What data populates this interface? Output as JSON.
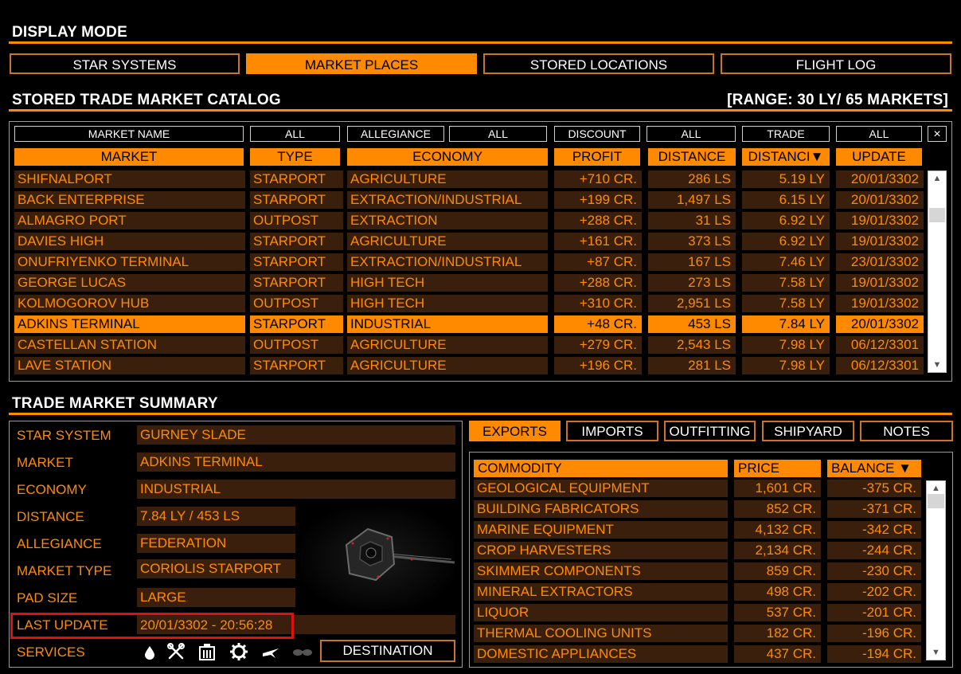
{
  "display_mode": {
    "title": "DISPLAY MODE",
    "buttons": [
      {
        "label": "STAR SYSTEMS",
        "active": false
      },
      {
        "label": "MARKET PLACES",
        "active": true
      },
      {
        "label": "STORED LOCATIONS",
        "active": false
      },
      {
        "label": "FLIGHT LOG",
        "active": false
      }
    ]
  },
  "catalog": {
    "title": "STORED TRADE MARKET CATALOG",
    "range": "[RANGE: 30 LY/ 65 MARKETS]",
    "filters": [
      "MARKET NAME",
      "ALL",
      "ALLEGIANCE",
      "ALL",
      "DISCOUNT",
      "ALL",
      "TRADE",
      "ALL"
    ],
    "close": "×",
    "columns": [
      "MARKET",
      "TYPE",
      "ECONOMY",
      "PROFIT",
      "DISTANCE",
      "DISTANCI▼",
      "UPDATE"
    ],
    "rows": [
      [
        "SHIFNALPORT",
        "STARPORT",
        "AGRICULTURE",
        "+710 CR.",
        "286 LS",
        "5.19 LY",
        "20/01/3302"
      ],
      [
        "BACK ENTERPRISE",
        "STARPORT",
        "EXTRACTION/INDUSTRIAL",
        "+199 CR.",
        "1,497 LS",
        "6.15 LY",
        "20/01/3302"
      ],
      [
        "ALMAGRO PORT",
        "OUTPOST",
        "EXTRACTION",
        "+288 CR.",
        "31 LS",
        "6.92 LY",
        "19/01/3302"
      ],
      [
        "DAVIES HIGH",
        "STARPORT",
        "AGRICULTURE",
        "+161 CR.",
        "373 LS",
        "6.92 LY",
        "19/01/3302"
      ],
      [
        "ONUFRIYENKO TERMINAL",
        "STARPORT",
        "EXTRACTION/INDUSTRIAL",
        "+87 CR.",
        "167 LS",
        "7.46 LY",
        "23/01/3302"
      ],
      [
        "GEORGE LUCAS",
        "STARPORT",
        "HIGH TECH",
        "+288 CR.",
        "273 LS",
        "7.58 LY",
        "19/01/3302"
      ],
      [
        "KOLMOGOROV HUB",
        "OUTPOST",
        "HIGH TECH",
        "+310 CR.",
        "2,951 LS",
        "7.58 LY",
        "19/01/3302"
      ],
      [
        "ADKINS TERMINAL",
        "STARPORT",
        "INDUSTRIAL",
        "+48 CR.",
        "453 LS",
        "7.84 LY",
        "20/01/3302"
      ],
      [
        "CASTELLAN STATION",
        "OUTPOST",
        "AGRICULTURE",
        "+279 CR.",
        "2,543 LS",
        "7.98 LY",
        "06/12/3301"
      ],
      [
        "LAVE STATION",
        "STARPORT",
        "AGRICULTURE",
        "+196 CR.",
        "281 LS",
        "7.98 LY",
        "06/12/3301"
      ]
    ],
    "selected_row": "ADKINS TERMINAL"
  },
  "summary": {
    "title": "TRADE MARKET SUMMARY",
    "fields": {
      "star_system": {
        "label": "STAR SYSTEM",
        "value": "GURNEY SLADE"
      },
      "market": {
        "label": "MARKET",
        "value": "ADKINS TERMINAL"
      },
      "economy": {
        "label": "ECONOMY",
        "value": "INDUSTRIAL"
      },
      "distance": {
        "label": "DISTANCE",
        "value": "7.84 LY / 453 LS"
      },
      "allegiance": {
        "label": "ALLEGIANCE",
        "value": "FEDERATION"
      },
      "market_type": {
        "label": "MARKET TYPE",
        "value": "CORIOLIS STARPORT"
      },
      "pad_size": {
        "label": "PAD SIZE",
        "value": "LARGE"
      },
      "last_update": {
        "label": "LAST UPDATE",
        "value": "20/01/3302 - 20:56:28"
      }
    },
    "services_label": "SERVICES",
    "service_icons": [
      "refuel-icon",
      "repair-icon",
      "rearm-icon",
      "outfitting-icon",
      "shipyard-icon",
      "black-market-icon"
    ],
    "destination_label": "DESTINATION"
  },
  "tabs": [
    {
      "label": "EXPORTS",
      "active": true
    },
    {
      "label": "IMPORTS",
      "active": false
    },
    {
      "label": "OUTFITTING",
      "active": false
    },
    {
      "label": "SHIPYARD",
      "active": false
    },
    {
      "label": "NOTES",
      "active": false
    }
  ],
  "commodities": {
    "columns": [
      "COMMODITY",
      "PRICE",
      "BALANCE ▼"
    ],
    "rows": [
      [
        "GEOLOGICAL EQUIPMENT",
        "1,601 CR.",
        "-375 CR."
      ],
      [
        "BUILDING FABRICATORS",
        "852 CR.",
        "-371 CR."
      ],
      [
        "MARINE EQUIPMENT",
        "4,132 CR.",
        "-342 CR."
      ],
      [
        "CROP HARVESTERS",
        "2,134 CR.",
        "-244 CR."
      ],
      [
        "SKIMMER COMPONENTS",
        "859 CR.",
        "-230 CR."
      ],
      [
        "MINERAL EXTRACTORS",
        "498 CR.",
        "-202 CR."
      ],
      [
        "LIQUOR",
        "537 CR.",
        "-201 CR."
      ],
      [
        "THERMAL COOLING UNITS",
        "182 CR.",
        "-196 CR."
      ],
      [
        "DOMESTIC APPLIANCES",
        "437 CR.",
        "-194 CR."
      ]
    ]
  },
  "colors": {
    "accent": "#ff8a00",
    "cell_bg": "#3a200c",
    "highlight": "#e01010"
  }
}
